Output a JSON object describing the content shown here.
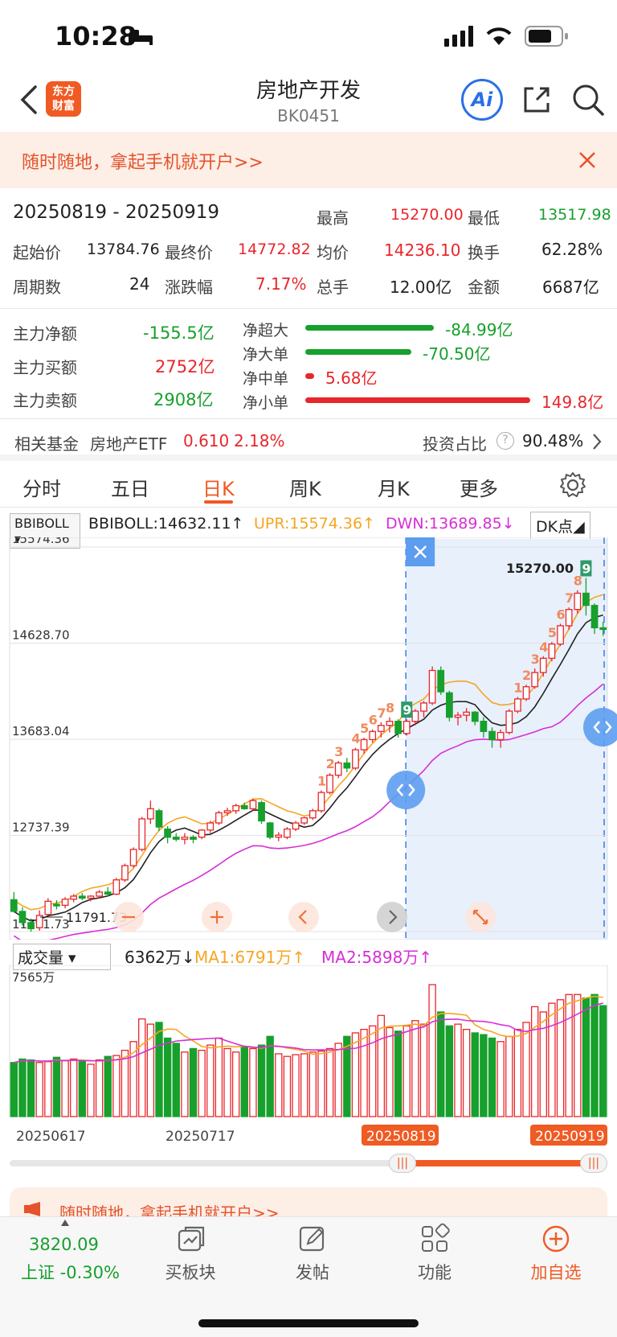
{
  "status": {
    "time": "10:28"
  },
  "nav": {
    "title": "房地产开发",
    "code": "BK0451",
    "logo_line1": "东方",
    "logo_line2": "财富",
    "ai_label": "Ai"
  },
  "banner": {
    "text": "随时随地，拿起手机就开户>>"
  },
  "summary": {
    "range": "20250819 - 20250919",
    "high_label": "最高",
    "high": "15270.00",
    "low_label": "最低",
    "low": "13517.98",
    "start_label": "起始价",
    "start": "13784.76",
    "final_label": "最终价",
    "final": "14772.82",
    "avg_label": "均价",
    "avg": "14236.10",
    "turnover_label": "换手",
    "turnover": "62.28%",
    "period_label": "周期数",
    "period": "24",
    "change_label": "涨跌幅",
    "change": "7.17%",
    "hands_label": "总手",
    "hands": "12.00亿",
    "amount_label": "金额",
    "amount": "6687亿"
  },
  "flow": {
    "net_label": "主力净额",
    "net": "-155.5亿",
    "buy_label": "主力买额",
    "buy": "2752亿",
    "sell_label": "主力卖额",
    "sell": "2908亿",
    "bars": [
      {
        "label": "净超大",
        "value": "-84.99亿",
        "ratio": 0.57,
        "color": "#17a02c"
      },
      {
        "label": "净大单",
        "value": "-70.50亿",
        "ratio": 0.47,
        "color": "#17a02c"
      },
      {
        "label": "净中单",
        "value": "5.68亿",
        "ratio": 0.04,
        "color": "#e8262b"
      },
      {
        "label": "净小单",
        "value": "149.8亿",
        "ratio": 1.0,
        "color": "#e8262b"
      }
    ]
  },
  "fund": {
    "label": "相关基金",
    "name": "房地产ETF",
    "price": "0.610",
    "change": "2.18%",
    "ratio_label": "投资占比",
    "ratio": "90.48%"
  },
  "tabs": [
    "分时",
    "五日",
    "日K",
    "周K",
    "月K",
    "更多"
  ],
  "active_tab": "日K",
  "indicator": {
    "name": "BBIBOLL",
    "bbi": "BBIBOLL:14632.11↑",
    "upr": "UPR:15574.36↑",
    "dwn": "DWN:13689.85↓",
    "dk": "DK点"
  },
  "chart_data": [
    {
      "type": "candlestick",
      "y_labels": [
        "15574.36",
        "14628.70",
        "13683.04",
        "12737.39",
        "11791.73"
      ],
      "ylim": [
        11791.73,
        15574.36
      ],
      "annotations": {
        "high_point": "15270.00",
        "low_point": "11791.73"
      },
      "selection": {
        "start": "20250819",
        "end": "20250919"
      },
      "candles": [
        [
          12105,
          12180,
          11980,
          11990
        ],
        [
          11990,
          12030,
          11850,
          11880
        ],
        [
          11880,
          11920,
          11790,
          11820
        ],
        [
          11830,
          12000,
          11800,
          11950
        ],
        [
          11960,
          12120,
          11950,
          12090
        ],
        [
          12060,
          12100,
          12010,
          12050
        ],
        [
          12050,
          12130,
          12020,
          12110
        ],
        [
          12110,
          12160,
          12080,
          12140
        ],
        [
          12140,
          12170,
          12100,
          12120
        ],
        [
          12120,
          12150,
          12090,
          12140
        ],
        [
          12140,
          12200,
          12120,
          12180
        ],
        [
          12180,
          12230,
          12140,
          12160
        ],
        [
          12160,
          12320,
          12150,
          12300
        ],
        [
          12300,
          12460,
          12280,
          12440
        ],
        [
          12440,
          12620,
          12420,
          12600
        ],
        [
          12600,
          12920,
          12580,
          12900
        ],
        [
          12900,
          13080,
          12850,
          13000
        ],
        [
          12980,
          13000,
          12780,
          12820
        ],
        [
          12800,
          12830,
          12660,
          12720
        ],
        [
          12720,
          12760,
          12680,
          12700
        ],
        [
          12700,
          12760,
          12650,
          12720
        ],
        [
          12720,
          12740,
          12660,
          12700
        ],
        [
          12720,
          12800,
          12700,
          12790
        ],
        [
          12790,
          12880,
          12760,
          12860
        ],
        [
          12860,
          12980,
          12840,
          12960
        ],
        [
          12960,
          13010,
          12930,
          12980
        ],
        [
          12980,
          13050,
          12950,
          13030
        ],
        [
          13030,
          13060,
          12990,
          13000
        ],
        [
          13000,
          13100,
          12980,
          13080
        ],
        [
          13060,
          13080,
          12850,
          12880
        ],
        [
          12860,
          12870,
          12700,
          12720
        ],
        [
          12720,
          12770,
          12680,
          12740
        ],
        [
          12720,
          12820,
          12700,
          12800
        ],
        [
          12800,
          12880,
          12780,
          12860
        ],
        [
          12860,
          12920,
          12840,
          12910
        ],
        [
          12910,
          13000,
          12890,
          12980
        ],
        [
          12980,
          13180,
          12960,
          13160
        ],
        [
          13160,
          13350,
          13140,
          13330
        ],
        [
          13330,
          13470,
          13300,
          13450
        ],
        [
          13450,
          13500,
          13360,
          13400
        ],
        [
          13400,
          13600,
          13380,
          13580
        ],
        [
          13580,
          13700,
          13540,
          13680
        ],
        [
          13680,
          13780,
          13650,
          13760
        ],
        [
          13760,
          13850,
          13700,
          13820
        ],
        [
          13820,
          13900,
          13750,
          13860
        ],
        [
          13860,
          13880,
          13700,
          13740
        ],
        [
          13740,
          13880,
          13720,
          13860
        ],
        [
          13860,
          13980,
          13820,
          13960
        ],
        [
          13960,
          14060,
          13900,
          14040
        ],
        [
          14040,
          14400,
          14020,
          14360
        ],
        [
          14360,
          14400,
          14120,
          14150
        ],
        [
          14140,
          14160,
          13860,
          13900
        ],
        [
          13900,
          13950,
          13820,
          13920
        ],
        [
          13920,
          13990,
          13860,
          13950
        ],
        [
          13950,
          13960,
          13820,
          13860
        ],
        [
          13860,
          13900,
          13700,
          13760
        ],
        [
          13760,
          13800,
          13600,
          13680
        ],
        [
          13680,
          13780,
          13600,
          13750
        ],
        [
          13750,
          13980,
          13730,
          13960
        ],
        [
          13960,
          14100,
          13940,
          14080
        ],
        [
          14080,
          14220,
          14060,
          14200
        ],
        [
          14200,
          14380,
          14180,
          14340
        ],
        [
          14340,
          14500,
          14300,
          14480
        ],
        [
          14480,
          14640,
          14450,
          14620
        ],
        [
          14620,
          14820,
          14600,
          14800
        ],
        [
          14800,
          14980,
          14760,
          14960
        ],
        [
          14960,
          15150,
          14920,
          15120
        ],
        [
          15120,
          15270,
          14900,
          15000
        ],
        [
          15000,
          15020,
          14720,
          14780
        ],
        [
          14780,
          14840,
          14700,
          14772
        ]
      ]
    },
    {
      "type": "bar",
      "name": "成交量",
      "current": "6362万↓",
      "ma1": "MA1:6791万↑",
      "ma2": "MA2:5898万↑",
      "top_label": "7565万",
      "values": [
        3100,
        3300,
        3250,
        3100,
        3150,
        3400,
        3200,
        3300,
        3150,
        3000,
        3250,
        3450,
        3500,
        3800,
        4300,
        5600,
        5300,
        5400,
        4500,
        4200,
        3700,
        3900,
        3800,
        4100,
        4500,
        3900,
        3700,
        4000,
        3900,
        4100,
        4600,
        3600,
        3450,
        3550,
        3600,
        3700,
        3750,
        3900,
        4200,
        4600,
        4800,
        5000,
        5200,
        5800,
        5100,
        4900,
        5200,
        5500,
        5300,
        7565,
        6000,
        5200,
        5300,
        5000,
        4800,
        4700,
        4500,
        4300,
        4600,
        5000,
        5400,
        6300,
        6000,
        6500,
        6700,
        7000,
        7000,
        6800,
        7000,
        6362
      ],
      "dates": [
        "20250617",
        "20250717",
        "20250819",
        "20250919"
      ]
    }
  ],
  "bottom": {
    "index_value": "3820.09",
    "index_label": "上证 -0.30%",
    "items": [
      "买板块",
      "发帖",
      "功能",
      "加自选"
    ]
  }
}
